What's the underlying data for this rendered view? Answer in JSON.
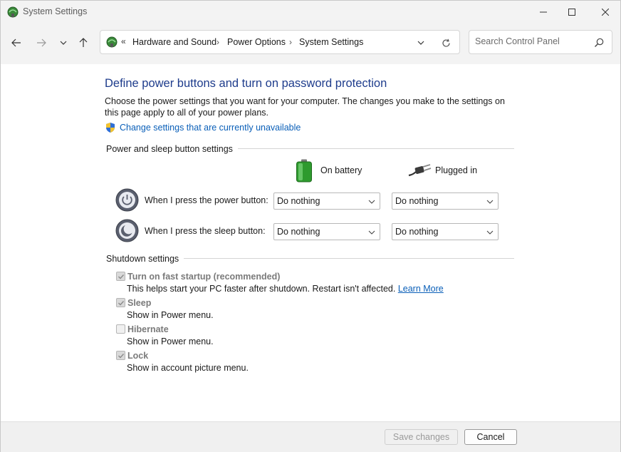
{
  "window": {
    "title": "System Settings"
  },
  "nav": {
    "breadcrumbs": [
      "Hardware and Sound",
      "Power Options",
      "System Settings"
    ],
    "search_placeholder": "Search Control Panel"
  },
  "content": {
    "heading": "Define power buttons and turn on password protection",
    "description": "Choose the power settings that you want for your computer. The changes you make to the settings on this page apply to all of your power plans.",
    "change_link": "Change settings that are currently unavailable",
    "power_section": {
      "title": "Power and sleep button settings",
      "columns": [
        "On battery",
        "Plugged in"
      ],
      "rows": [
        {
          "label": "When I press the power button:",
          "battery": "Do nothing",
          "plugged": "Do nothing"
        },
        {
          "label": "When I press the sleep button:",
          "battery": "Do nothing",
          "plugged": "Do nothing"
        }
      ]
    },
    "shutdown_section": {
      "title": "Shutdown settings",
      "items": [
        {
          "label": "Turn on fast startup (recommended)",
          "desc": "This helps start your PC faster after shutdown. Restart isn't affected.",
          "link": "Learn More",
          "checked": true
        },
        {
          "label": "Sleep",
          "desc": "Show in Power menu.",
          "checked": true
        },
        {
          "label": "Hibernate",
          "desc": "Show in Power menu.",
          "checked": false
        },
        {
          "label": "Lock",
          "desc": "Show in account picture menu.",
          "checked": true
        }
      ]
    }
  },
  "footer": {
    "save_label": "Save changes",
    "cancel_label": "Cancel"
  }
}
